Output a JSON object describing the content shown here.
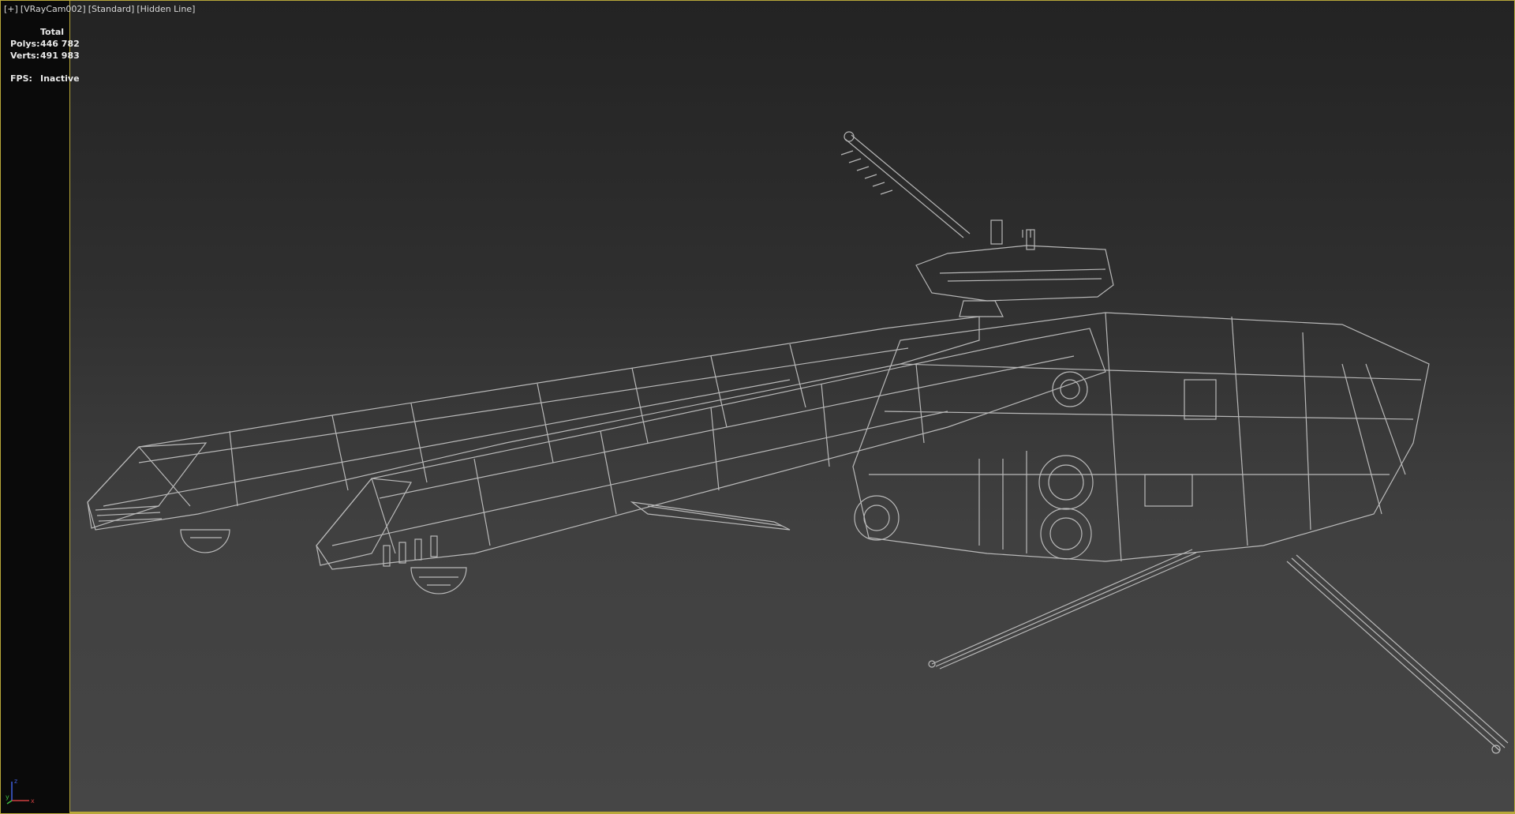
{
  "viewport": {
    "labels": [
      "[+]",
      "[VRayCam002]",
      "[Standard]",
      "[Hidden Line]"
    ]
  },
  "stats": {
    "header": "Total",
    "polys_label": "Polys:",
    "polys_value": "446 782",
    "verts_label": "Verts:",
    "verts_value": "491 983",
    "fps_label": "FPS:",
    "fps_value": "Inactive"
  },
  "axis_gizmo": {
    "z": "z",
    "y": "y",
    "x": "x"
  },
  "colors": {
    "border": "#b8a83a",
    "wire": "#cfcfcf",
    "axis_x": "#d04040",
    "axis_y": "#40c040",
    "axis_z": "#4060e0"
  }
}
